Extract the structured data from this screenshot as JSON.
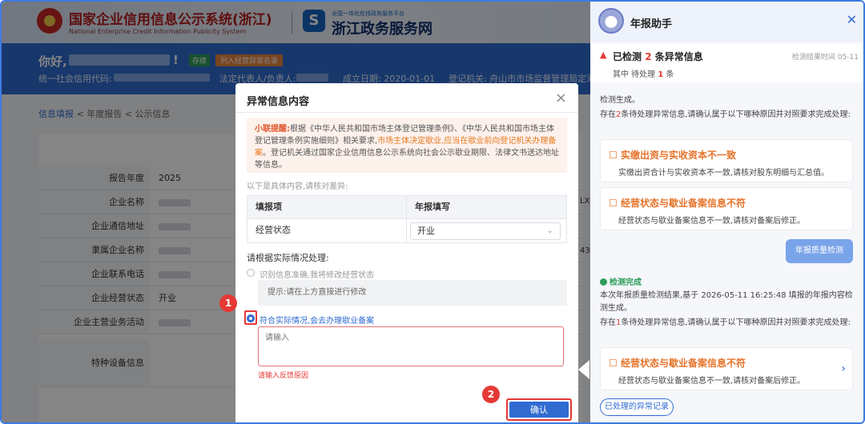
{
  "header": {
    "sys_title": "国家企业信用信息公示系统(浙江)",
    "sys_sub": "National Enterprise Credit Information Publicity System",
    "gov_top": "全国一体化在线政务服务平台",
    "gov_name": "浙江政务服务网",
    "gov_logo": "S"
  },
  "infobar": {
    "hello": "你好,",
    "excl": "!",
    "tag_status": "存续",
    "tag_abnormal": "列入经营异常名录",
    "credit_code": "统一社会信用代码:",
    "legal_rep": "法定代表人/负责人:",
    "found_date": "成立日期: 2020-01-01",
    "reg_org": "登记机关: 舟山市市场监督管理局定海分"
  },
  "breadcrumb": {
    "item1": "信息填报",
    "item2": "年度报告",
    "item3": "公示信息",
    "sep": "<"
  },
  "form": {
    "rows": [
      {
        "label": "报告年度",
        "value": "2025"
      },
      {
        "label": "企业名称",
        "value": ""
      },
      {
        "label": "企业通信地址",
        "value": ""
      },
      {
        "label": "隶属企业名称",
        "value": ""
      },
      {
        "label": "企业联系电话",
        "value": ""
      },
      {
        "label": "企业经营状态",
        "value": "开业"
      },
      {
        "label": "企业主营业务活动",
        "value": ""
      }
    ],
    "special_label": "特种设备信息",
    "edge1": "LX",
    "edge2": "43"
  },
  "modal": {
    "title": "异常信息内容",
    "tip_lead": "小联提醒:",
    "tip_body": "根据《中华人民共和国市场主体登记管理条例》、《中华人民共和国市场主体登记管理条例实施细则》相关要求,",
    "tip_highlight": "市场主体决定歇业,应当在歇业前向登记机关办理备案",
    "tip_tail": "。登记机关通过国家企业信用信息公示系统向社会公示歇业期限、法律文书送达地址等信息。",
    "compare_hint": "以下是具体内容,请核对差异:",
    "table": {
      "col1": "填报项",
      "col2": "年报填写",
      "row_item": "经营状态",
      "row_value": "开业"
    },
    "handle_label": "请根据实际情况处理:",
    "option1": "识别信息准确,我将修改经营状态",
    "option1_hint": "提示:请在上方直接进行修改",
    "option2": "符合实际情况,会去办理歇业备案",
    "textarea_placeholder": "请输入",
    "error_text": "请输入反馈原因",
    "confirm": "确认"
  },
  "markers": {
    "step1": "1",
    "step2": "2"
  },
  "assistant": {
    "title": "年报助手",
    "detect_prefix": "已检测",
    "detect_count": "2",
    "detect_suffix": "条异常信息",
    "detect_time": "检测结果时间 05-11",
    "pending_prefix": "其中 待处理",
    "pending_count": "1",
    "pending_suffix": "条",
    "gen": "检测生成。",
    "exist_prefix": "存在",
    "exist_count": "2",
    "exist_suffix": "条待处理异常信息,请确认属于以下哪种原因并对照要求完成处理:",
    "card1_title": "实缴出资与实收资本不一致",
    "card1_desc": "实缴出资合计与实收资本不一致,请核对股东明细与汇总值。",
    "card2_title": "经营状态与歇业备案信息不符",
    "card2_desc": "经营状态与歇业备案信息不一致,请核对备案后修正。",
    "bubble": "年报质量检测",
    "done": "检测完成",
    "result_text": "本次年报质量检测结果,基于 2026-05-11 16:25:48 填报的年报内容检测生成。",
    "exist2_prefix": "存在",
    "exist2_count": "1",
    "exist2_suffix": "条待处理异常信息,请确认属于以下哪种原因并对照要求完成处理:",
    "card3_title": "经营状态与歇业备案信息不符",
    "card3_desc": "经营状态与歇业备案信息不一致,请核对备案后修正。",
    "history": "已处理的异常记录"
  },
  "colors": {
    "accent": "#2f6bd0",
    "alert": "#e53935",
    "warn": "#e6732a",
    "ok": "#2e9e5a"
  }
}
